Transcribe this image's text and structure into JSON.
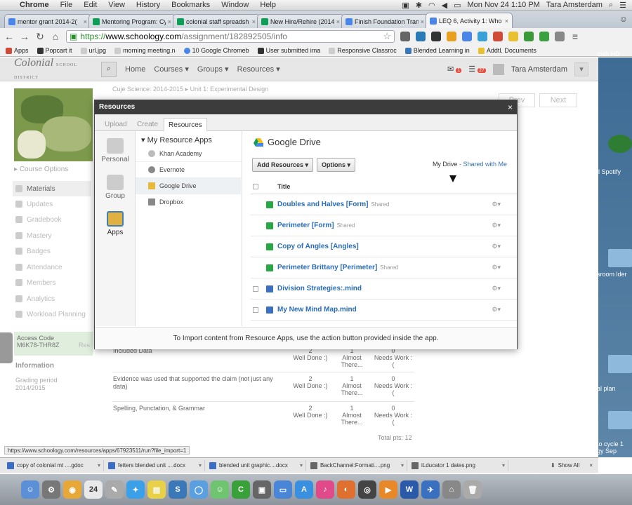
{
  "menubar": {
    "app": "Chrome",
    "items": [
      "File",
      "Edit",
      "View",
      "History",
      "Bookmarks",
      "Window",
      "Help"
    ],
    "clock": "Mon Nov 24  1:10 PM",
    "user": "Tara Amsterdam"
  },
  "tabs": [
    {
      "title": "mentor grant 2014-2(",
      "color": "#4a86e8"
    },
    {
      "title": "Mentoring Program: Cy",
      "color": "#0f9d58"
    },
    {
      "title": "colonial staff spreadsh",
      "color": "#0f9d58"
    },
    {
      "title": "New Hire/Rehire (2014",
      "color": "#0f9d58"
    },
    {
      "title": "Finish Foundation Tran",
      "color": "#4a86e8"
    },
    {
      "title": "LEQ 6, Activity 1: Who",
      "color": "#4a86e8"
    }
  ],
  "omnibox": {
    "scheme": "https://",
    "host": "www.schoology.com",
    "path": "/assignment/182892505/info"
  },
  "bookmarks": [
    "Apps",
    "Popcart it",
    "url.jpg",
    "morning meeting.n",
    "10 Google Chromeb",
    "User submitted ima",
    "Responsive Classroc",
    "Blended Learning in",
    "Addtl. Documents"
  ],
  "schoology": {
    "logo": "Colonial",
    "logo_sub": "SCHOOL DISTRICT",
    "nav": [
      "Home",
      "Courses",
      "Groups",
      "Resources"
    ],
    "badges": [
      "1",
      "27"
    ],
    "user": "Tara Amsterdam"
  },
  "sidebar": {
    "course_options": "Course Options",
    "items": [
      "Materials",
      "Updates",
      "Gradebook",
      "Mastery",
      "Badges",
      "Attendance",
      "Members",
      "Analytics",
      "Workload Planning"
    ],
    "access_label": "Access Code",
    "access_code": "M6K78-THR8Z",
    "access_extra": "Res",
    "info": "Information",
    "grading_label": "Grading period",
    "grading_value": "2014/2015"
  },
  "background": {
    "breadcrumb": "Cuje Science: 2014-2015 ▸ Unit 1: Experimental Design",
    "prev": "Prev",
    "next": "Next",
    "rows": [
      {
        "criterion": "Included Data",
        "scores": [
          [
            "2",
            "Well Done :)"
          ],
          [
            "1",
            "Almost There..."
          ],
          [
            "0",
            "Needs Work :("
          ]
        ]
      },
      {
        "criterion": "Evidence was used that supported the claim (not just any data)",
        "scores": [
          [
            "2",
            "Well Done :)"
          ],
          [
            "1",
            "Almost There..."
          ],
          [
            "0",
            "Needs Work :("
          ]
        ]
      },
      {
        "criterion": "Spelling, Punctation, & Grammar",
        "scores": [
          [
            "2",
            "Well Done :)"
          ],
          [
            "1",
            "Almost There..."
          ],
          [
            "0",
            "Needs Work :("
          ]
        ]
      }
    ],
    "total": "Total pts: 12"
  },
  "desktop_labels": [
    "tosh HD",
    "ll Spotify",
    "sroom lder",
    "al plan",
    "to cycle 1 gy Sep"
  ],
  "modal": {
    "title": "Resources",
    "tabs": [
      "Upload",
      "Create",
      "Resources"
    ],
    "categories": [
      "Personal",
      "Group",
      "Apps"
    ],
    "apps_header": "My Resource Apps",
    "apps": [
      "Khan Academy",
      "Evernote",
      "Google Drive",
      "Dropbox"
    ],
    "drive_title": "Google Drive",
    "add_button": "Add Resources",
    "options_button": "Options",
    "my_drive": "My Drive",
    "separator": "-",
    "shared_with_me": "Shared with Me",
    "column_title": "Title",
    "files": [
      {
        "name": "Doubles and Halves [Form]",
        "shared": "Shared",
        "kind": "form"
      },
      {
        "name": "Perimeter [Form]",
        "shared": "Shared",
        "kind": "form"
      },
      {
        "name": "Copy of Angles [Angles]",
        "shared": "",
        "kind": "form"
      },
      {
        "name": "Perimeter Brittany [Perimeter]",
        "shared": "Shared",
        "kind": "form"
      },
      {
        "name": "Division Strategies:.mind",
        "shared": "",
        "kind": "doc"
      },
      {
        "name": "My New Mind Map.mind",
        "shared": "",
        "kind": "doc"
      }
    ],
    "footer": "To Import content from Resource Apps, use the action button provided inside the app."
  },
  "status_url": "https://www.schoology.com/resources/apps/67923511/run?file_import=1",
  "downloads": [
    "copy of colonial mt ....gdoc",
    "fetters blended unit ....docx",
    "blended unit graphic....docx",
    "BackChannel:Formati....png",
    "iLducator 1 dates.png"
  ],
  "show_all": "Show All",
  "dock": [
    {
      "glyph": "☺",
      "color": "#5b8fd6"
    },
    {
      "glyph": "⚙",
      "color": "#777"
    },
    {
      "glyph": "◉",
      "color": "#e8a838"
    },
    {
      "glyph": "24",
      "color": "#e9e9e9"
    },
    {
      "glyph": "✎",
      "color": "#aaa"
    },
    {
      "glyph": "✦",
      "color": "#3aa0e8"
    },
    {
      "glyph": "▤",
      "color": "#e8d048"
    },
    {
      "glyph": "S",
      "color": "#3a78b8"
    },
    {
      "glyph": "◯",
      "color": "#5aa0e0"
    },
    {
      "glyph": "☺",
      "color": "#6fc56f"
    },
    {
      "glyph": "C",
      "color": "#3aa03a"
    },
    {
      "glyph": "▣",
      "color": "#666"
    },
    {
      "glyph": "▭",
      "color": "#4a86d8"
    },
    {
      "glyph": "A",
      "color": "#3a90e0"
    },
    {
      "glyph": "♪",
      "color": "#e04a8a"
    },
    {
      "glyph": "◐",
      "color": "#e07030"
    },
    {
      "glyph": "◎",
      "color": "#444"
    },
    {
      "glyph": "▶",
      "color": "#e88828"
    },
    {
      "glyph": "W",
      "color": "#2a5aa8"
    },
    {
      "glyph": "✈",
      "color": "#3a70c0"
    },
    {
      "glyph": "⌂",
      "color": "#888"
    },
    {
      "glyph": "🗑",
      "color": "#aaa"
    }
  ]
}
